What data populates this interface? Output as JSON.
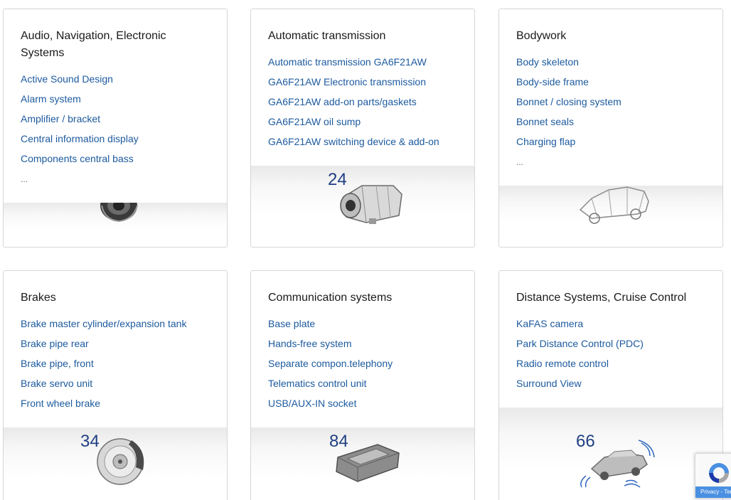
{
  "cards": [
    {
      "title": "Audio, Navigation, Electronic Systems",
      "links": [
        "Active Sound Design",
        "Alarm system",
        "Amplifier / bracket",
        "Central information display",
        "Components central bass"
      ],
      "more": "...",
      "count": ""
    },
    {
      "title": "Automatic transmission",
      "links": [
        "Automatic transmission GA6F21AW",
        "GA6F21AW Electronic transmission",
        "GA6F21AW add-on parts/gaskets",
        "GA6F21AW oil sump",
        "GA6F21AW switching device & add-on"
      ],
      "more": "",
      "count": "24"
    },
    {
      "title": "Bodywork",
      "links": [
        "Body skeleton",
        "Body-side frame",
        "Bonnet / closing system",
        "Bonnet seals",
        "Charging flap"
      ],
      "more": "...",
      "count": ""
    },
    {
      "title": "Brakes",
      "links": [
        "Brake master cylinder/expansion tank",
        "Brake pipe rear",
        "Brake pipe, front",
        "Brake servo unit",
        "Front wheel brake"
      ],
      "more": "",
      "count": "34"
    },
    {
      "title": "Communication systems",
      "links": [
        "Base plate",
        "Hands-free system",
        "Separate compon.telephony",
        "Telematics control unit",
        "USB/AUX-IN socket"
      ],
      "more": "",
      "count": "84"
    },
    {
      "title": "Distance Systems, Cruise Control",
      "links": [
        "KaFAS camera",
        "Park Distance Control (PDC)",
        "Radio remote control",
        "Surround View"
      ],
      "more": "",
      "count": "66"
    }
  ],
  "recaptcha": {
    "terms": "Privacy - Terms"
  },
  "colors": {
    "link": "#1c5a9e",
    "count": "#1f3f83",
    "border": "#d6d6d6"
  }
}
